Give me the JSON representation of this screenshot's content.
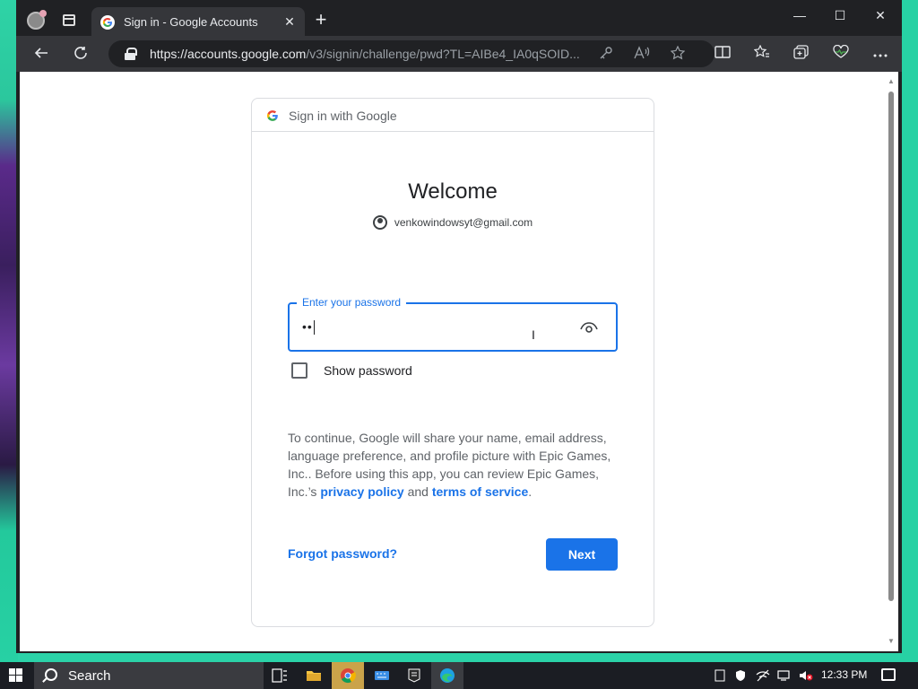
{
  "browser": {
    "tab_title": "Sign in - Google Accounts",
    "tab_close": "✕",
    "new_tab": "+",
    "url_host": "https://accounts.google.com",
    "url_path": "/v3/signin/challenge/pwd?TL=AIBe4_IA0qSOID...",
    "minimize": "—",
    "maximize": "☐",
    "close": "✕"
  },
  "card": {
    "header": "Sign in with Google",
    "welcome": "Welcome",
    "email": "venkowindowsyt@gmail.com",
    "password_label": "Enter your password",
    "password_value": "••",
    "show_password": "Show password",
    "consent_text_1": "To continue, Google will share your name, email address, language preference, and profile picture with Epic Games, Inc.. Before using this app, you can review Epic Games, Inc.’s ",
    "privacy_link": "privacy policy",
    "and": " and ",
    "terms_link": "terms of service",
    "period": ".",
    "forgot_password": "Forgot password?",
    "next_button": "Next"
  },
  "taskbar": {
    "search_text": "Search",
    "time": "12:33 PM"
  },
  "colors": {
    "accent": "#1a73e8",
    "browser_dark": "#202124",
    "taskbar": "#1b1d23"
  }
}
